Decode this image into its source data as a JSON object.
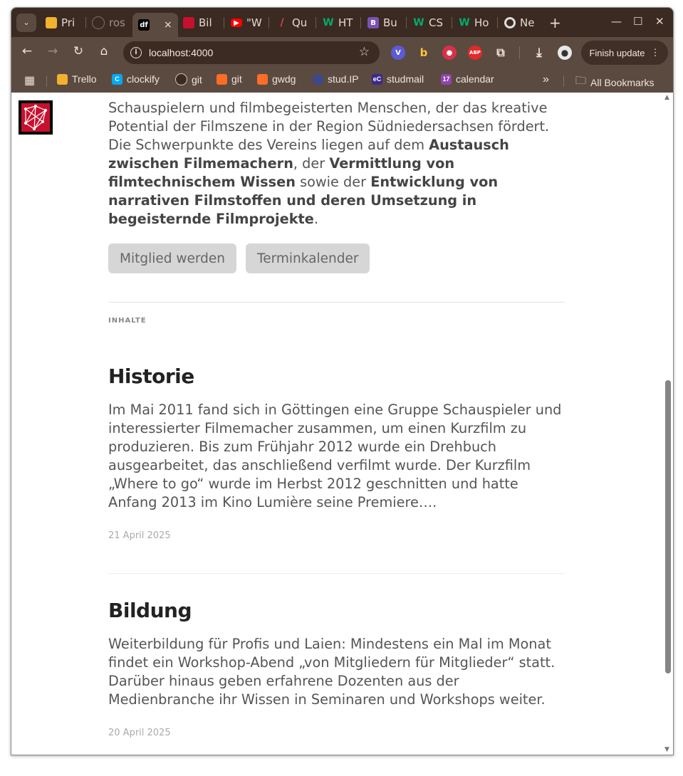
{
  "browser": {
    "tabs": [
      {
        "title": "Pri",
        "icon": "trello-icon",
        "color": "#f2b22e"
      },
      {
        "title": "ros",
        "icon": "github-icon",
        "color": "#24292f"
      },
      {
        "title": "",
        "icon": "df-icon",
        "color": "#000000",
        "active": true,
        "icon_text": "df"
      },
      {
        "title": "Bil",
        "icon": "network-logo-icon",
        "color": "#c8102e"
      },
      {
        "title": "\"W",
        "icon": "youtube-icon",
        "color": "#ff0000"
      },
      {
        "title": "Qu",
        "icon": "pen-icon",
        "color": "#e04848"
      },
      {
        "title": "HT",
        "icon": "w3schools-icon",
        "color": "#04aa6d"
      },
      {
        "title": "Bu",
        "icon": "bootstrap-icon",
        "color": "#7952b3"
      },
      {
        "title": "CS",
        "icon": "w3schools-icon",
        "color": "#04aa6d"
      },
      {
        "title": "Ho",
        "icon": "w3schools-icon",
        "color": "#04aa6d"
      },
      {
        "title": "Ne",
        "icon": "chrome-icon",
        "color": "#dddddd"
      }
    ],
    "active_tab_close": "×",
    "new_tab": "+",
    "address": "localhost:4000",
    "finish_update": "Finish update",
    "bookmarks": [
      {
        "label": "Trello",
        "icon": "trello-icon",
        "color": "#f2b22e"
      },
      {
        "label": "clockify",
        "icon": "clockify-icon",
        "color": "#03a9f4"
      },
      {
        "label": "git",
        "icon": "github-icon",
        "color": "#24292f"
      },
      {
        "label": "git",
        "icon": "gitlab-icon",
        "color": "#fc6d26"
      },
      {
        "label": "gwdg",
        "icon": "gitlab-icon",
        "color": "#fc6d26"
      },
      {
        "label": "stud.IP",
        "icon": "studip-icon",
        "color": "#3c4a8c"
      },
      {
        "label": "studmail",
        "icon": "mail-icon",
        "color": "#3b2a8c"
      },
      {
        "label": "calendar",
        "icon": "calendar-icon",
        "color": "#8e44ad"
      }
    ],
    "more_bookmarks": "»",
    "all_bookmarks": "All Bookmarks"
  },
  "page": {
    "intro_parts": [
      {
        "text": "Schauspielern und filmbegeisterten Menschen, der das kreative Potential der Filmszene in der Region Südniedersachsen fördert. Die Schwerpunkte des Vereins liegen auf dem ",
        "bold": false
      },
      {
        "text": "Austausch zwischen Filmemachern",
        "bold": true
      },
      {
        "text": ", der ",
        "bold": false
      },
      {
        "text": "Vermittlung von filmtechnischem Wissen",
        "bold": true
      },
      {
        "text": " sowie der ",
        "bold": false
      },
      {
        "text": "Entwicklung von narrativen Filmstoffen und deren Umsetzung in begeisternde Filmprojekte",
        "bold": true
      },
      {
        "text": ".",
        "bold": false
      }
    ],
    "buttons": {
      "join": "Mitglied werden",
      "calendar": "Terminkalender"
    },
    "section_label": "INHALTE",
    "posts": [
      {
        "title": "Historie",
        "excerpt": "Im Mai 2011 fand sich in Göttingen eine Gruppe Schauspieler und interessierter Filmemacher zusammen, um einen Kurzfilm zu produzieren. Bis zum Frühjahr 2012 wurde ein Drehbuch ausgearbeitet, das anschließend verfilmt wurde. Der Kurzfilm „Where to go“ wurde im Herbst 2012 geschnitten und hatte Anfang 2013 im Kino Lumière seine Premiere….",
        "date": "21 April 2025"
      },
      {
        "title": "Bildung",
        "excerpt": "Weiterbildung für Profis und Laien: Mindestens ein Mal im Monat findet ein Workshop-Abend „von Mitgliedern für Mitglieder“ statt. Darüber hinaus geben erfahrene Dozenten aus der Medienbranche ihr Wissen in Seminaren und Workshops weiter.",
        "date": "20 April 2025"
      }
    ]
  }
}
